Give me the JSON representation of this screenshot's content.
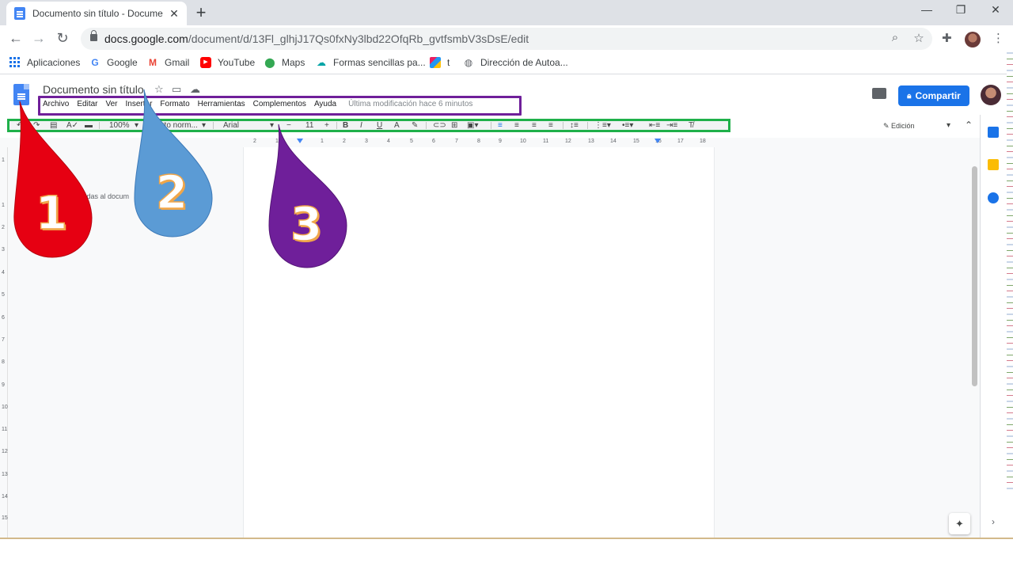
{
  "browser": {
    "tab_title": "Documento sin título - Documen",
    "tab_close": "✕",
    "new_tab": "+",
    "window_controls": {
      "minimize": "—",
      "restore": "❐",
      "close": "✕"
    },
    "url_host": "docs.google.com",
    "url_path": "/document/d/13Fl_glhjJ17Qs0fxNy3lbd22OfqRb_gvtfsmbV3sDsE/edit",
    "bookmarks": [
      {
        "label": "Aplicaciones",
        "icon": "apps-grid-icon"
      },
      {
        "label": "Google",
        "icon": "google-icon"
      },
      {
        "label": "Gmail",
        "icon": "gmail-icon"
      },
      {
        "label": "YouTube",
        "icon": "youtube-icon"
      },
      {
        "label": "Maps",
        "icon": "maps-pin-icon"
      },
      {
        "label": "Formas sencillas pa...",
        "icon": "cloud-icon"
      },
      {
        "label": "t",
        "icon": "colorful-logo-icon"
      },
      {
        "label": "Dirección de Autoa...",
        "icon": "globe-icon"
      }
    ]
  },
  "docs": {
    "title": "Documento sin título",
    "menu": [
      "Archivo",
      "Editar",
      "Ver",
      "Insertar",
      "Formato",
      "Herramientas",
      "Complementos",
      "Ayuda"
    ],
    "last_edit": "Última modificación hace 6 minutos",
    "share_label": "Compartir",
    "toolbar": {
      "zoom": "100%",
      "style": "Texto norm...",
      "font": "Arial",
      "size": "11"
    },
    "mode": "Edición",
    "outline_text": "...das al docum",
    "ruler_ticks": [
      "2",
      "1",
      "1",
      "2",
      "3",
      "4",
      "5",
      "6",
      "7",
      "8",
      "9",
      "10",
      "11",
      "12",
      "13",
      "14",
      "15",
      "16",
      "17",
      "18"
    ],
    "vruler_ticks": [
      "1",
      "1",
      "2",
      "3",
      "4",
      "5",
      "6",
      "7",
      "8",
      "9",
      "10",
      "11",
      "12",
      "13",
      "14",
      "15"
    ]
  },
  "annotations": [
    {
      "number": "1",
      "color": "#e60012"
    },
    {
      "number": "2",
      "color": "#5b9bd5"
    },
    {
      "number": "3",
      "color": "#6f1f9a"
    }
  ],
  "colors": {
    "highlight_menu": "#6f1f9a",
    "highlight_toolbar": "#1fb04a",
    "share_button": "#1a73e8"
  }
}
